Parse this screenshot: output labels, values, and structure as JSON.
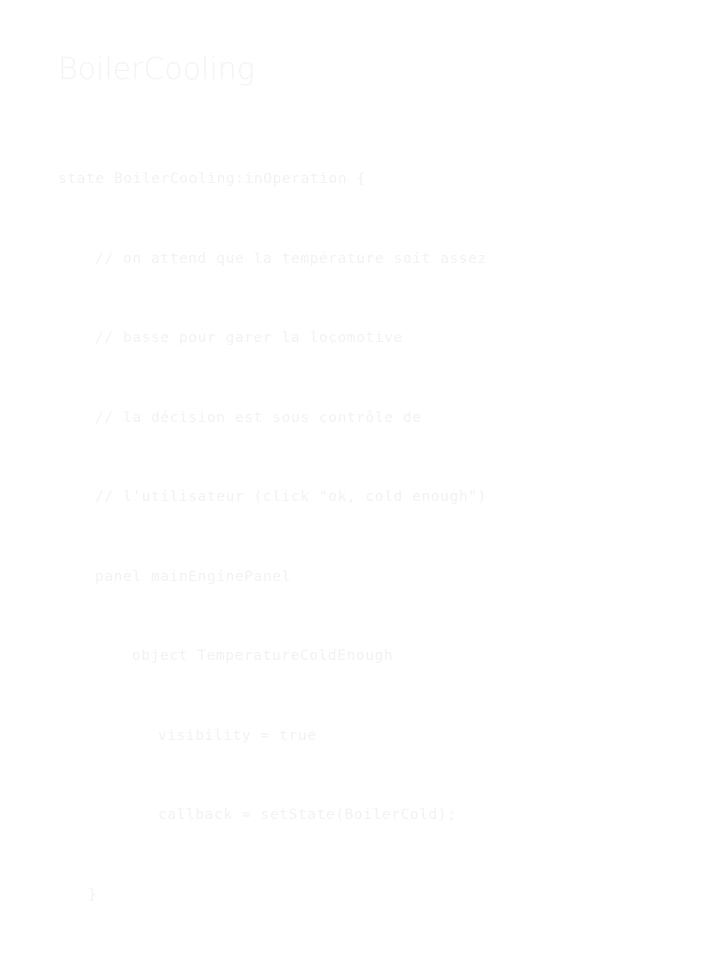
{
  "slide": {
    "title": "BoilerCooling",
    "background_color": "#ffffff",
    "text_color": "#f2f2f2",
    "title_color": "#f3f3f3"
  },
  "code": {
    "language": "state-machine-dsl",
    "lines": [
      {
        "indent": 0,
        "text": "state BoilerCooling:inOperation {"
      },
      {
        "indent": 1,
        "text": "// on attend que la température soit assez"
      },
      {
        "indent": 1,
        "text": "// basse pour garer la locomotive"
      },
      {
        "indent": 1,
        "text": "// la décision est sous contrôle de"
      },
      {
        "indent": 1,
        "text": "// l'utilisateur (click \"ok, cold enough\")"
      },
      {
        "indent": 1,
        "text": "panel mainEnginePanel"
      },
      {
        "indent": 2,
        "text": "object TemperatureColdEnough"
      },
      {
        "indent": 3,
        "text": "visibility = true"
      },
      {
        "indent": 3,
        "text": "callback = setState(BoilerCold);"
      },
      {
        "indent": "close",
        "text": "}"
      }
    ]
  }
}
